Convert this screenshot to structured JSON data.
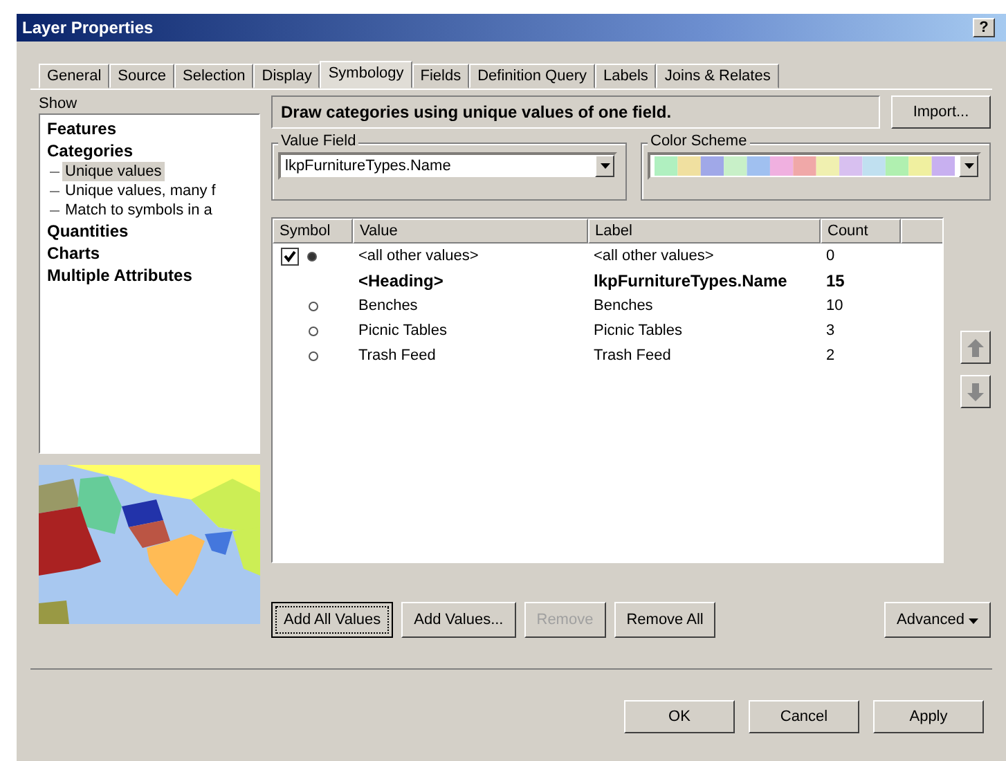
{
  "window": {
    "title": "Layer Properties",
    "help": "?"
  },
  "tabs": [
    {
      "label": "General",
      "selected": false
    },
    {
      "label": "Source",
      "selected": false
    },
    {
      "label": "Selection",
      "selected": false
    },
    {
      "label": "Display",
      "selected": false
    },
    {
      "label": "Symbology",
      "selected": true
    },
    {
      "label": "Fields",
      "selected": false
    },
    {
      "label": "Definition Query",
      "selected": false
    },
    {
      "label": "Labels",
      "selected": false
    },
    {
      "label": "Joins & Relates",
      "selected": false
    }
  ],
  "show": {
    "label": "Show",
    "items": [
      {
        "label": "Features",
        "selected": false
      },
      {
        "label": "Categories",
        "selected": false,
        "children": [
          {
            "label": "Unique values",
            "selected": true
          },
          {
            "label": "Unique values, many f",
            "selected": false
          },
          {
            "label": "Match to symbols in a",
            "selected": false
          }
        ]
      },
      {
        "label": "Quantities",
        "selected": false
      },
      {
        "label": "Charts",
        "selected": false
      },
      {
        "label": "Multiple Attributes",
        "selected": false
      }
    ]
  },
  "description": "Draw categories using unique values of one field.",
  "import_button": "Import...",
  "value_field": {
    "label": "Value Field",
    "value": "lkpFurnitureTypes.Name"
  },
  "color_scheme": {
    "label": "Color Scheme"
  },
  "table": {
    "columns": [
      "Symbol",
      "Value",
      "Label",
      "Count"
    ],
    "rows": [
      {
        "kind": "other",
        "checked": true,
        "value": "<all other values>",
        "label": "<all other values>",
        "count": "0"
      },
      {
        "kind": "heading",
        "value": "<Heading>",
        "label": "lkpFurnitureTypes.Name",
        "count": "15"
      },
      {
        "kind": "value",
        "value": "Benches",
        "label": "Benches",
        "count": "10"
      },
      {
        "kind": "value",
        "value": "Picnic Tables",
        "label": "Picnic Tables",
        "count": "3"
      },
      {
        "kind": "value",
        "value": "Trash Feed",
        "label": "Trash Feed",
        "count": "2"
      }
    ]
  },
  "action_buttons": [
    {
      "label": "Add All Values",
      "disabled": false
    },
    {
      "label": "Add Values...",
      "disabled": false
    },
    {
      "label": "Remove",
      "disabled": true
    },
    {
      "label": "Remove All",
      "disabled": false
    }
  ],
  "advanced_button": "Advanced",
  "dialog_buttons": [
    "OK",
    "Cancel",
    "Apply"
  ]
}
